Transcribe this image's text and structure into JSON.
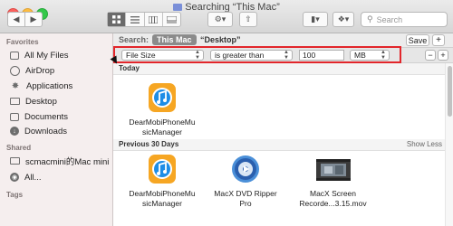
{
  "window": {
    "title": "Searching “This Mac”"
  },
  "toolbar": {
    "back_icon": "chevron-left-icon",
    "forward_icon": "chevron-right-icon",
    "view_modes": [
      "icon-view-icon",
      "list-view-icon",
      "column-view-icon",
      "coverflow-view-icon"
    ],
    "selected_view": 0,
    "search_placeholder": "Search"
  },
  "sidebar": {
    "favorites_header": "Favorites",
    "favorites": [
      {
        "label": "All My Files",
        "icon": "all-files-icon"
      },
      {
        "label": "AirDrop",
        "icon": "airdrop-icon"
      },
      {
        "label": "Applications",
        "icon": "applications-icon"
      },
      {
        "label": "Desktop",
        "icon": "desktop-icon"
      },
      {
        "label": "Documents",
        "icon": "documents-icon"
      },
      {
        "label": "Downloads",
        "icon": "downloads-icon"
      }
    ],
    "shared_header": "Shared",
    "shared": [
      {
        "label": "scmacmini的Mac mini",
        "icon": "computer-icon"
      },
      {
        "label": "All...",
        "icon": "network-icon"
      }
    ],
    "tags_header": "Tags"
  },
  "searchbar": {
    "label": "Search:",
    "scope_selected": "This Mac",
    "scope_other": "“Desktop”",
    "save_label": "Save",
    "add_label": "+"
  },
  "criteria": {
    "attribute": "File Size",
    "operator": "is greater than",
    "value": "100",
    "unit": "MB",
    "remove_label": "−",
    "add_label": "+"
  },
  "sections": {
    "today": {
      "label": "Today",
      "files": [
        {
          "name_line1": "DearMobiPhoneMu",
          "name_line2": "sicManager",
          "icon": "itunes-app-icon"
        }
      ]
    },
    "previous": {
      "label": "Previous 30 Days",
      "show_less": "Show Less",
      "files": [
        {
          "name_line1": "DearMobiPhoneMu",
          "name_line2": "sicManager",
          "icon": "itunes-app-icon"
        },
        {
          "name_line1": "MacX DVD Ripper",
          "name_line2": "Pro",
          "icon": "dvd-ripper-app-icon"
        },
        {
          "name_line1": "MacX Screen",
          "name_line2": "Recorde...3.15.mov",
          "icon": "video-file-icon"
        }
      ]
    }
  },
  "colors": {
    "highlight": "#e2262b",
    "itunes_orange": "#f6a623",
    "itunes_blue": "#1e8de6"
  }
}
